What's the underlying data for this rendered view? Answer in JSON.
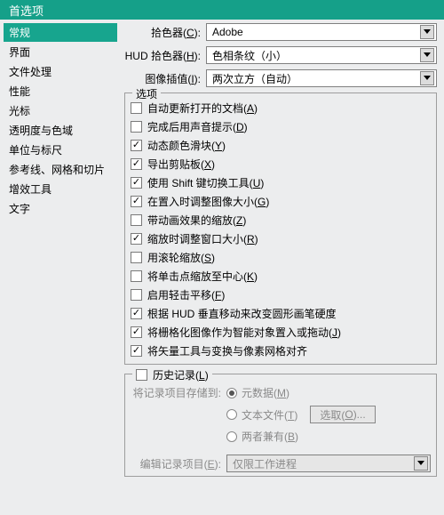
{
  "window": {
    "title": "首选项"
  },
  "sidebar": {
    "items": [
      {
        "label": "常规"
      },
      {
        "label": "界面"
      },
      {
        "label": "文件处理"
      },
      {
        "label": "性能"
      },
      {
        "label": "光标"
      },
      {
        "label": "透明度与色域"
      },
      {
        "label": "单位与标尺"
      },
      {
        "label": "参考线、网格和切片"
      },
      {
        "label": "增效工具"
      },
      {
        "label": "文字"
      }
    ],
    "selected": 0
  },
  "pickers": {
    "color_picker_label_pre": "拾色器(",
    "color_picker_key": "C",
    "color_picker_label_post": "):",
    "color_picker_value": "Adobe",
    "hud_label_pre": "HUD 拾色器(",
    "hud_key": "H",
    "hud_label_post": "):",
    "hud_value": "色相条纹（小）",
    "interp_label_pre": "图像插值(",
    "interp_key": "I",
    "interp_label_post": "):",
    "interp_value": "两次立方（自动）"
  },
  "options": {
    "legend": "选项",
    "items": [
      {
        "checked": false,
        "pre": "自动更新打开的文档(",
        "key": "A",
        "post": ")"
      },
      {
        "checked": false,
        "pre": "完成后用声音提示(",
        "key": "D",
        "post": ")"
      },
      {
        "checked": true,
        "pre": "动态颜色滑块(",
        "key": "Y",
        "post": ")"
      },
      {
        "checked": true,
        "pre": "导出剪贴板(",
        "key": "X",
        "post": ")"
      },
      {
        "checked": true,
        "pre": "使用 Shift 键切换工具(",
        "key": "U",
        "post": ")"
      },
      {
        "checked": true,
        "pre": "在置入时调整图像大小(",
        "key": "G",
        "post": ")"
      },
      {
        "checked": false,
        "pre": "带动画效果的缩放(",
        "key": "Z",
        "post": ")"
      },
      {
        "checked": true,
        "pre": "缩放时调整窗口大小(",
        "key": "R",
        "post": ")"
      },
      {
        "checked": false,
        "pre": "用滚轮缩放(",
        "key": "S",
        "post": ")"
      },
      {
        "checked": false,
        "pre": "将单击点缩放至中心(",
        "key": "K",
        "post": ")"
      },
      {
        "checked": false,
        "pre": "启用轻击平移(",
        "key": "F",
        "post": ")"
      },
      {
        "checked": true,
        "pre": "根据 HUD 垂直移动来改变圆形画笔硬度",
        "key": "",
        "post": ""
      },
      {
        "checked": true,
        "pre": "将栅格化图像作为智能对象置入或拖动(",
        "key": "J",
        "post": ")"
      },
      {
        "checked": true,
        "pre": "将矢量工具与变换与像素网格对齐",
        "key": "",
        "post": ""
      }
    ]
  },
  "history": {
    "legend_pre": "历史记录(",
    "legend_key": "L",
    "legend_post": ")",
    "legend_checked": false,
    "save_to_label": "将记录项目存储到:",
    "radios": [
      {
        "checked": true,
        "pre": "元数据(",
        "key": "M",
        "post": ")"
      },
      {
        "checked": false,
        "pre": "文本文件(",
        "key": "T",
        "post": ")"
      },
      {
        "checked": false,
        "pre": "两者兼有(",
        "key": "B",
        "post": ")"
      }
    ],
    "choose_btn_pre": "选取(",
    "choose_btn_key": "O",
    "choose_btn_post": ")...",
    "edit_label_pre": "编辑记录项目(",
    "edit_key": "E",
    "edit_label_post": "):",
    "edit_value": "仅限工作进程"
  }
}
